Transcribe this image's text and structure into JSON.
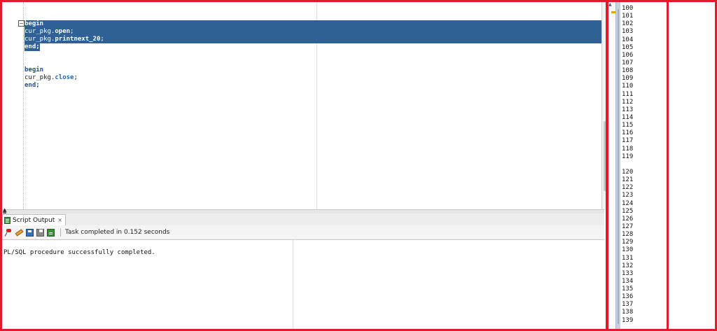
{
  "editor": {
    "code": [
      {
        "kind": "kw",
        "text": "begin",
        "selected": true
      },
      {
        "kind": "call",
        "pkg": "cur_pkg.",
        "method": "open",
        "tail": ";",
        "selected": true
      },
      {
        "kind": "call",
        "pkg": "cur_pkg.",
        "method": "printnext_20",
        "tail": ";",
        "selected": true
      },
      {
        "kind": "kw",
        "text": "end;",
        "selected": true
      },
      {
        "kind": "blank"
      },
      {
        "kind": "blank"
      },
      {
        "kind": "kw",
        "text": "begin",
        "selected": false
      },
      {
        "kind": "call",
        "pkg": "cur_pkg.",
        "method": "close",
        "tail": ";",
        "selected": false
      },
      {
        "kind": "kw",
        "text": "end;",
        "selected": false
      }
    ]
  },
  "output_panel": {
    "tab_label": "Script Output",
    "tab_close": "×",
    "status": "Task completed in 0.152 seconds",
    "message": "PL/SQL procedure successfully completed."
  },
  "line_numbers": [
    "100",
    "101",
    "102",
    "103",
    "104",
    "105",
    "106",
    "107",
    "108",
    "109",
    "110",
    "111",
    "112",
    "113",
    "114",
    "115",
    "116",
    "117",
    "118",
    "119",
    "",
    "120",
    "121",
    "122",
    "123",
    "124",
    "125",
    "126",
    "127",
    "128",
    "129",
    "130",
    "131",
    "132",
    "133",
    "134",
    "135",
    "136",
    "137",
    "138",
    "139"
  ],
  "colors": {
    "selection": "#2f6197",
    "annotation_frame": "#e21b2b",
    "marker": "#e8a300"
  }
}
